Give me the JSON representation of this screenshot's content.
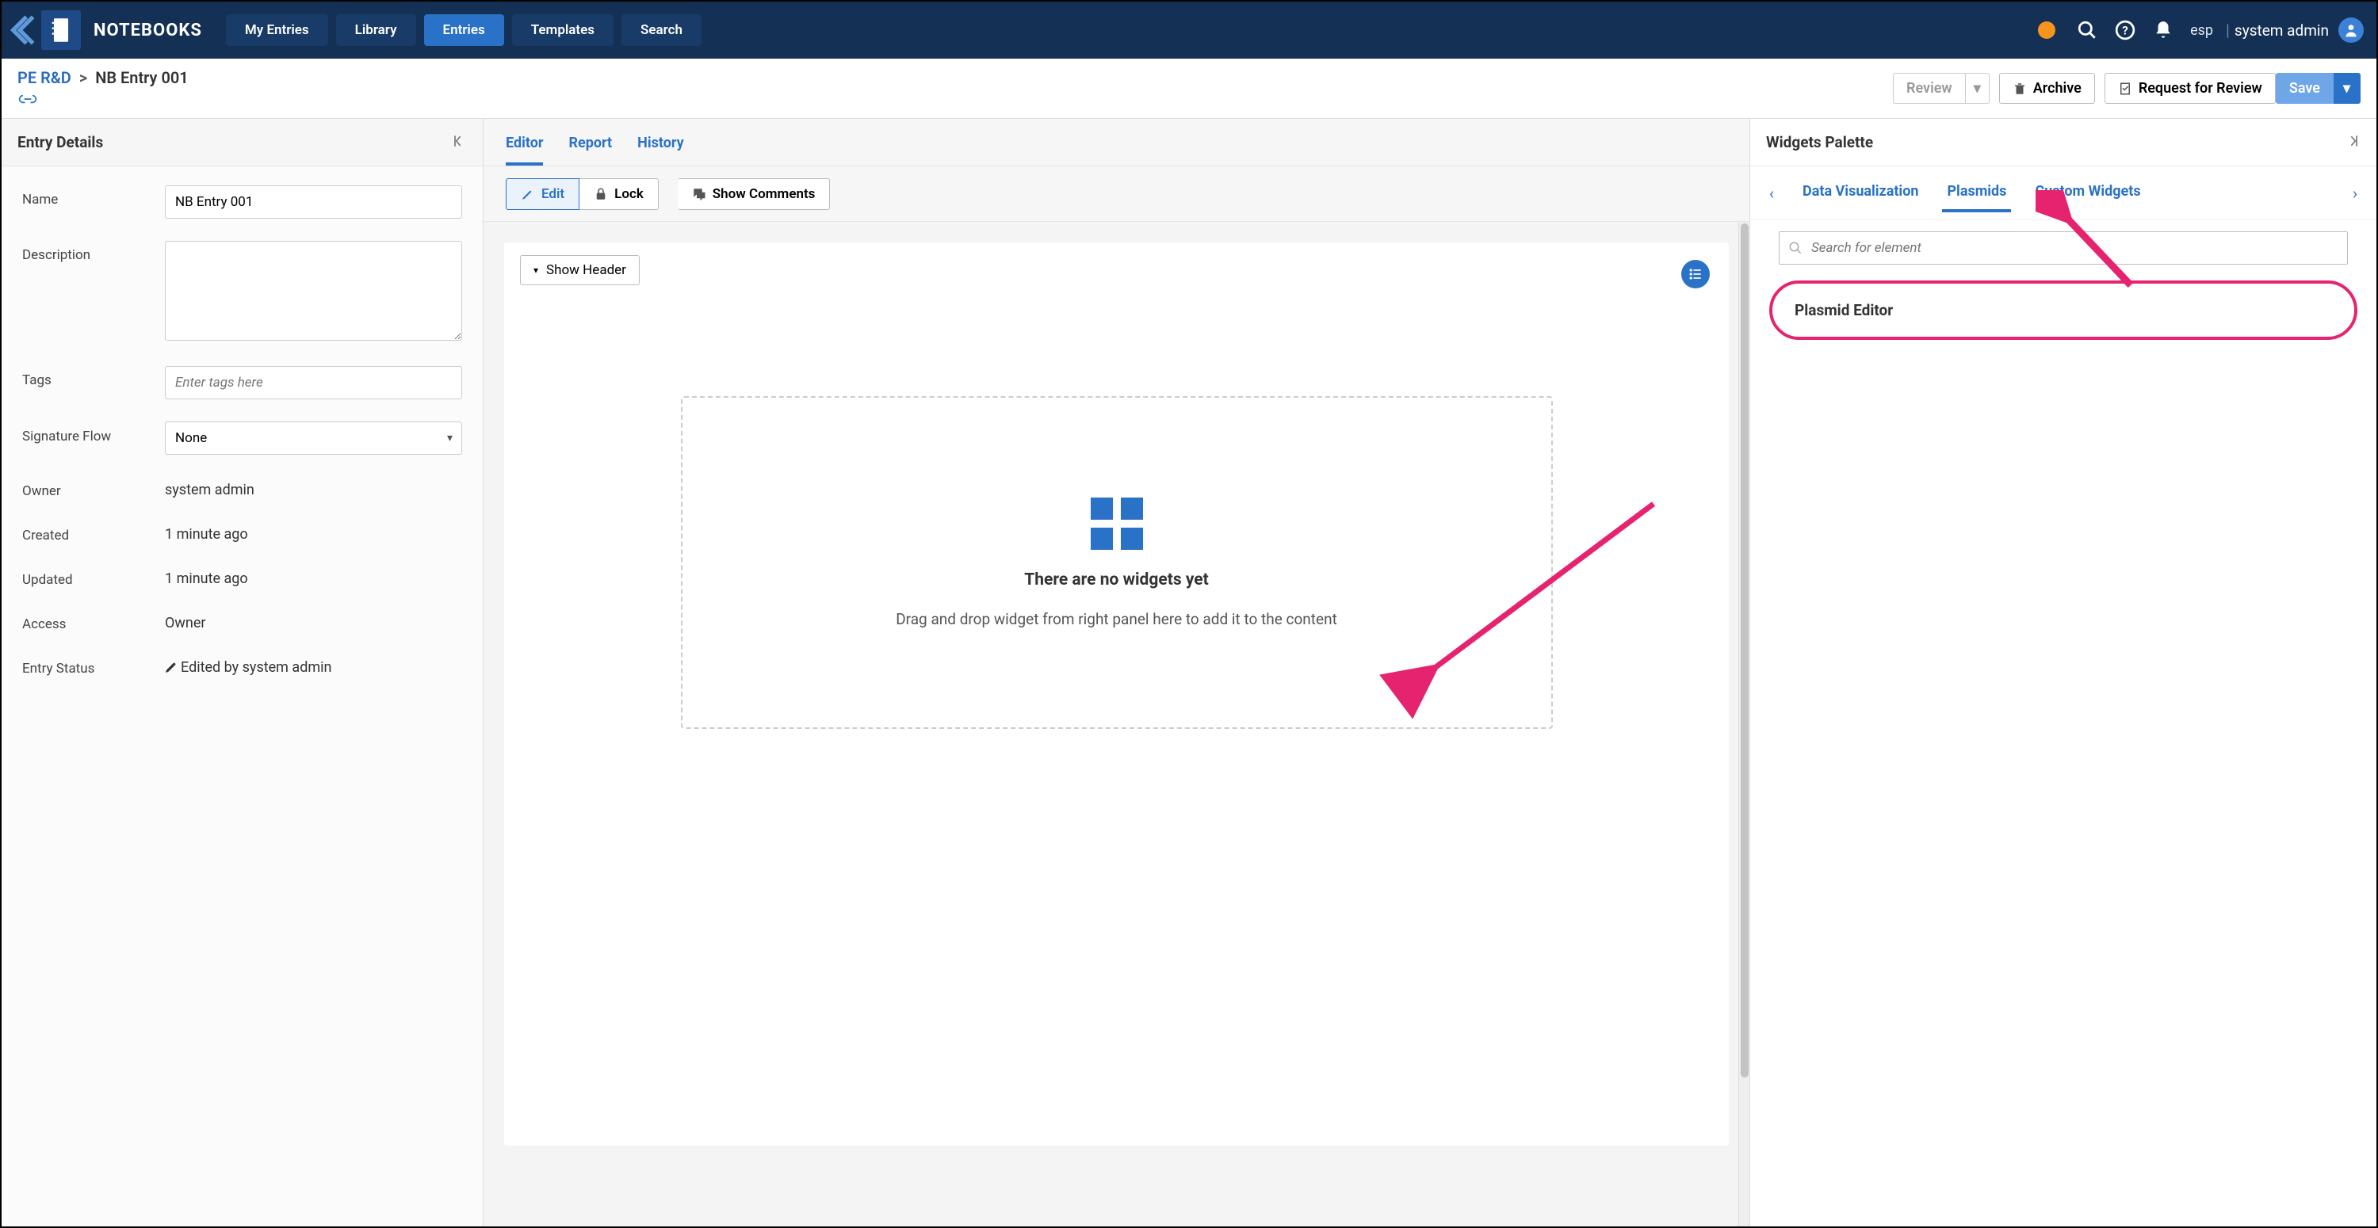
{
  "colors": {
    "accent": "#2a72c7",
    "annotation": "#e6236e",
    "navbg": "#143054"
  },
  "topnav": {
    "app_title": "NOTEBOOKS",
    "tabs": [
      "My Entries",
      "Library",
      "Entries",
      "Templates",
      "Search"
    ],
    "active_tab_index": 2,
    "esp": "esp",
    "user": "system admin"
  },
  "breadcrumb": {
    "parent": "PE R&D",
    "sep": ">",
    "current": "NB Entry 001"
  },
  "actions": {
    "review": "Review",
    "archive": "Archive",
    "request": "Request for Review",
    "save": "Save"
  },
  "leftpanel": {
    "title": "Entry Details",
    "fields": {
      "name_label": "Name",
      "name_value": "NB Entry 001",
      "description_label": "Description",
      "description_value": "",
      "tags_label": "Tags",
      "tags_placeholder": "Enter tags here",
      "sigflow_label": "Signature Flow",
      "sigflow_value": "None",
      "owner_label": "Owner",
      "owner_value": "system admin",
      "created_label": "Created",
      "created_value": "1 minute ago",
      "updated_label": "Updated",
      "updated_value": "1 minute ago",
      "access_label": "Access",
      "access_value": "Owner",
      "status_label": "Entry Status",
      "status_value": "Edited by system admin"
    }
  },
  "center": {
    "tabs": [
      "Editor",
      "Report",
      "History"
    ],
    "active_tab": 0,
    "edit_btn": "Edit",
    "lock_btn": "Lock",
    "show_comments": "Show Comments",
    "show_header": "Show Header",
    "dropzone_title": "There are no widgets yet",
    "dropzone_sub": "Drag and drop widget from right panel here to add it to the content"
  },
  "rightpanel": {
    "title": "Widgets Palette",
    "tabs": [
      "Data Visualization",
      "Plasmids",
      "Custom Widgets"
    ],
    "active_tab": 1,
    "search_placeholder": "Search for element",
    "items": [
      {
        "label": "Plasmid Editor"
      }
    ]
  }
}
